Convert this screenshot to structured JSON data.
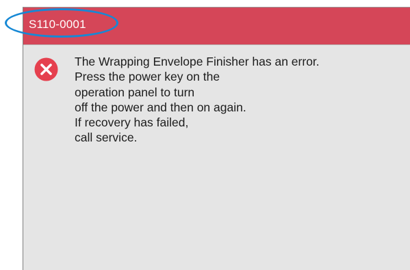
{
  "dialog": {
    "code": "S110-0001",
    "message_lines": [
      "The Wrapping Envelope Finisher has an error.",
      "Press the power key on the",
      "operation panel to turn",
      "off the power and then on again.",
      "If recovery has failed,",
      "call service."
    ],
    "icon": "error-x-icon"
  },
  "colors": {
    "titlebar": "#d54658",
    "panel": "#e5e5e5",
    "highlight": "#1688d5",
    "error_icon": "#e5404e"
  }
}
